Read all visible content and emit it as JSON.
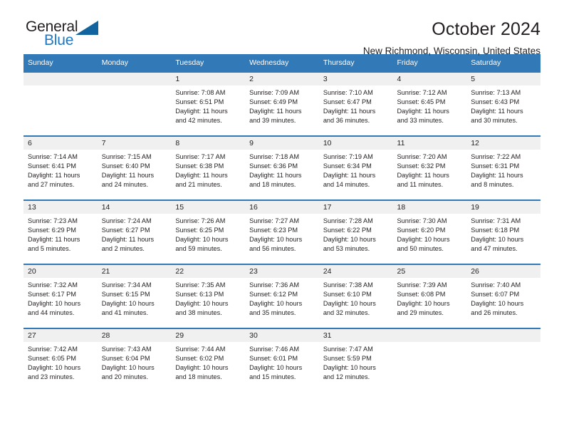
{
  "logo": {
    "text_top": "General",
    "text_bottom": "Blue",
    "color_top": "#231f20",
    "color_bottom": "#1f78c1",
    "triangle_color": "#12649f"
  },
  "header": {
    "month_title": "October 2024",
    "location": "New Richmond, Wisconsin, United States",
    "accent_color": "#3279b7"
  },
  "weekday_headers": [
    "Sunday",
    "Monday",
    "Tuesday",
    "Wednesday",
    "Thursday",
    "Friday",
    "Saturday"
  ],
  "labels": {
    "sunrise_prefix": "Sunrise:",
    "sunset_prefix": "Sunset:",
    "daylight_prefix": "Daylight:"
  },
  "weeks": [
    [
      {
        "day": "",
        "line1": "",
        "line2": "",
        "line3": "",
        "line4": ""
      },
      {
        "day": "",
        "line1": "",
        "line2": "",
        "line3": "",
        "line4": ""
      },
      {
        "day": "1",
        "line1": "Sunrise: 7:08 AM",
        "line2": "Sunset: 6:51 PM",
        "line3": "Daylight: 11 hours",
        "line4": "and 42 minutes."
      },
      {
        "day": "2",
        "line1": "Sunrise: 7:09 AM",
        "line2": "Sunset: 6:49 PM",
        "line3": "Daylight: 11 hours",
        "line4": "and 39 minutes."
      },
      {
        "day": "3",
        "line1": "Sunrise: 7:10 AM",
        "line2": "Sunset: 6:47 PM",
        "line3": "Daylight: 11 hours",
        "line4": "and 36 minutes."
      },
      {
        "day": "4",
        "line1": "Sunrise: 7:12 AM",
        "line2": "Sunset: 6:45 PM",
        "line3": "Daylight: 11 hours",
        "line4": "and 33 minutes."
      },
      {
        "day": "5",
        "line1": "Sunrise: 7:13 AM",
        "line2": "Sunset: 6:43 PM",
        "line3": "Daylight: 11 hours",
        "line4": "and 30 minutes."
      }
    ],
    [
      {
        "day": "6",
        "line1": "Sunrise: 7:14 AM",
        "line2": "Sunset: 6:41 PM",
        "line3": "Daylight: 11 hours",
        "line4": "and 27 minutes."
      },
      {
        "day": "7",
        "line1": "Sunrise: 7:15 AM",
        "line2": "Sunset: 6:40 PM",
        "line3": "Daylight: 11 hours",
        "line4": "and 24 minutes."
      },
      {
        "day": "8",
        "line1": "Sunrise: 7:17 AM",
        "line2": "Sunset: 6:38 PM",
        "line3": "Daylight: 11 hours",
        "line4": "and 21 minutes."
      },
      {
        "day": "9",
        "line1": "Sunrise: 7:18 AM",
        "line2": "Sunset: 6:36 PM",
        "line3": "Daylight: 11 hours",
        "line4": "and 18 minutes."
      },
      {
        "day": "10",
        "line1": "Sunrise: 7:19 AM",
        "line2": "Sunset: 6:34 PM",
        "line3": "Daylight: 11 hours",
        "line4": "and 14 minutes."
      },
      {
        "day": "11",
        "line1": "Sunrise: 7:20 AM",
        "line2": "Sunset: 6:32 PM",
        "line3": "Daylight: 11 hours",
        "line4": "and 11 minutes."
      },
      {
        "day": "12",
        "line1": "Sunrise: 7:22 AM",
        "line2": "Sunset: 6:31 PM",
        "line3": "Daylight: 11 hours",
        "line4": "and 8 minutes."
      }
    ],
    [
      {
        "day": "13",
        "line1": "Sunrise: 7:23 AM",
        "line2": "Sunset: 6:29 PM",
        "line3": "Daylight: 11 hours",
        "line4": "and 5 minutes."
      },
      {
        "day": "14",
        "line1": "Sunrise: 7:24 AM",
        "line2": "Sunset: 6:27 PM",
        "line3": "Daylight: 11 hours",
        "line4": "and 2 minutes."
      },
      {
        "day": "15",
        "line1": "Sunrise: 7:26 AM",
        "line2": "Sunset: 6:25 PM",
        "line3": "Daylight: 10 hours",
        "line4": "and 59 minutes."
      },
      {
        "day": "16",
        "line1": "Sunrise: 7:27 AM",
        "line2": "Sunset: 6:23 PM",
        "line3": "Daylight: 10 hours",
        "line4": "and 56 minutes."
      },
      {
        "day": "17",
        "line1": "Sunrise: 7:28 AM",
        "line2": "Sunset: 6:22 PM",
        "line3": "Daylight: 10 hours",
        "line4": "and 53 minutes."
      },
      {
        "day": "18",
        "line1": "Sunrise: 7:30 AM",
        "line2": "Sunset: 6:20 PM",
        "line3": "Daylight: 10 hours",
        "line4": "and 50 minutes."
      },
      {
        "day": "19",
        "line1": "Sunrise: 7:31 AM",
        "line2": "Sunset: 6:18 PM",
        "line3": "Daylight: 10 hours",
        "line4": "and 47 minutes."
      }
    ],
    [
      {
        "day": "20",
        "line1": "Sunrise: 7:32 AM",
        "line2": "Sunset: 6:17 PM",
        "line3": "Daylight: 10 hours",
        "line4": "and 44 minutes."
      },
      {
        "day": "21",
        "line1": "Sunrise: 7:34 AM",
        "line2": "Sunset: 6:15 PM",
        "line3": "Daylight: 10 hours",
        "line4": "and 41 minutes."
      },
      {
        "day": "22",
        "line1": "Sunrise: 7:35 AM",
        "line2": "Sunset: 6:13 PM",
        "line3": "Daylight: 10 hours",
        "line4": "and 38 minutes."
      },
      {
        "day": "23",
        "line1": "Sunrise: 7:36 AM",
        "line2": "Sunset: 6:12 PM",
        "line3": "Daylight: 10 hours",
        "line4": "and 35 minutes."
      },
      {
        "day": "24",
        "line1": "Sunrise: 7:38 AM",
        "line2": "Sunset: 6:10 PM",
        "line3": "Daylight: 10 hours",
        "line4": "and 32 minutes."
      },
      {
        "day": "25",
        "line1": "Sunrise: 7:39 AM",
        "line2": "Sunset: 6:08 PM",
        "line3": "Daylight: 10 hours",
        "line4": "and 29 minutes."
      },
      {
        "day": "26",
        "line1": "Sunrise: 7:40 AM",
        "line2": "Sunset: 6:07 PM",
        "line3": "Daylight: 10 hours",
        "line4": "and 26 minutes."
      }
    ],
    [
      {
        "day": "27",
        "line1": "Sunrise: 7:42 AM",
        "line2": "Sunset: 6:05 PM",
        "line3": "Daylight: 10 hours",
        "line4": "and 23 minutes."
      },
      {
        "day": "28",
        "line1": "Sunrise: 7:43 AM",
        "line2": "Sunset: 6:04 PM",
        "line3": "Daylight: 10 hours",
        "line4": "and 20 minutes."
      },
      {
        "day": "29",
        "line1": "Sunrise: 7:44 AM",
        "line2": "Sunset: 6:02 PM",
        "line3": "Daylight: 10 hours",
        "line4": "and 18 minutes."
      },
      {
        "day": "30",
        "line1": "Sunrise: 7:46 AM",
        "line2": "Sunset: 6:01 PM",
        "line3": "Daylight: 10 hours",
        "line4": "and 15 minutes."
      },
      {
        "day": "31",
        "line1": "Sunrise: 7:47 AM",
        "line2": "Sunset: 5:59 PM",
        "line3": "Daylight: 10 hours",
        "line4": "and 12 minutes."
      },
      {
        "day": "",
        "line1": "",
        "line2": "",
        "line3": "",
        "line4": ""
      },
      {
        "day": "",
        "line1": "",
        "line2": "",
        "line3": "",
        "line4": ""
      }
    ]
  ]
}
